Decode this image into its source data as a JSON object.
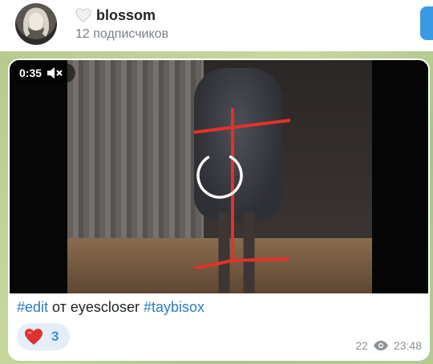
{
  "channel": {
    "name": "blossom",
    "subscribers": "12 подписчиков"
  },
  "message": {
    "video": {
      "duration": "0:35",
      "muted": true,
      "loading": true
    },
    "caption": {
      "tag1": "#edit",
      "middle": " от eyescloser ",
      "tag2": "#taybisox"
    },
    "reaction": {
      "emoji": "heart",
      "count": "3"
    },
    "views": "22",
    "time": "23:48"
  },
  "colors": {
    "accent": "#3a9ae6",
    "link": "#2b7cc2",
    "reaction_bg": "#e4eef8",
    "heart": "#e0302f"
  }
}
